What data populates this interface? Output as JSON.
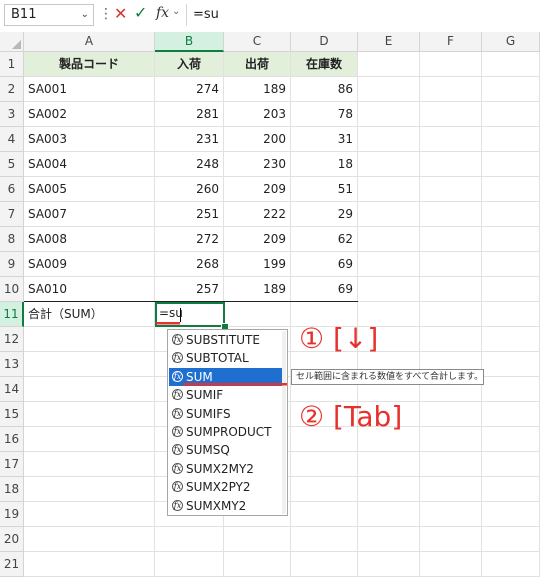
{
  "formula_bar": {
    "name_box": "B11",
    "formula": "=su"
  },
  "columns": [
    "A",
    "B",
    "C",
    "D",
    "E",
    "F",
    "G"
  ],
  "rows": [
    "1",
    "2",
    "3",
    "4",
    "5",
    "6",
    "7",
    "8",
    "9",
    "10",
    "11",
    "12",
    "13",
    "14",
    "15",
    "16",
    "17",
    "18",
    "19",
    "20",
    "21"
  ],
  "table": {
    "headers": [
      "製品コード",
      "入荷",
      "出荷",
      "在庫数"
    ],
    "rows": [
      [
        "SA001",
        "274",
        "189",
        "86"
      ],
      [
        "SA002",
        "281",
        "203",
        "78"
      ],
      [
        "SA003",
        "231",
        "200",
        "31"
      ],
      [
        "SA004",
        "248",
        "230",
        "18"
      ],
      [
        "SA005",
        "260",
        "209",
        "51"
      ],
      [
        "SA007",
        "251",
        "222",
        "29"
      ],
      [
        "SA008",
        "272",
        "209",
        "62"
      ],
      [
        "SA009",
        "268",
        "199",
        "69"
      ],
      [
        "SA010",
        "257",
        "189",
        "69"
      ]
    ],
    "total_label": "合計（SUM）",
    "total_entry": "=su"
  },
  "autocomplete": {
    "items": [
      "SUBSTITUTE",
      "SUBTOTAL",
      "SUM",
      "SUMIF",
      "SUMIFS",
      "SUMPRODUCT",
      "SUMSQ",
      "SUMX2MY2",
      "SUMX2PY2",
      "SUMXMY2"
    ],
    "selected": "SUM",
    "icon_glyph": "fx",
    "tooltip": "セル範囲に含まれる数値をすべて合計します。"
  },
  "annotations": {
    "step1": "① [↓]",
    "step2": "② [Tab]"
  },
  "colors": {
    "header_fill": "#e2efda",
    "active_border": "#107c41",
    "selection_blue": "#1f6fd1",
    "annotation_red": "#e8312d"
  }
}
